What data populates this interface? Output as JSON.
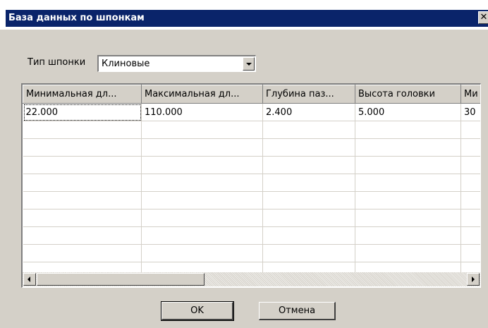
{
  "window": {
    "title": "База данных по шпонкам",
    "close_label": "✕"
  },
  "key_type": {
    "label": "Тип шпонки",
    "selected": "Клиновые"
  },
  "grid": {
    "columns": [
      "Минимальная дл...",
      "Максимальная дл...",
      "Глубина паз...",
      "Высота головки",
      "Ми"
    ],
    "rows": [
      [
        "22.000",
        "110.000",
        "2.400",
        "5.000",
        "30"
      ]
    ],
    "empty_row_count": 9
  },
  "buttons": {
    "ok": "OK",
    "cancel": "Отмена"
  }
}
